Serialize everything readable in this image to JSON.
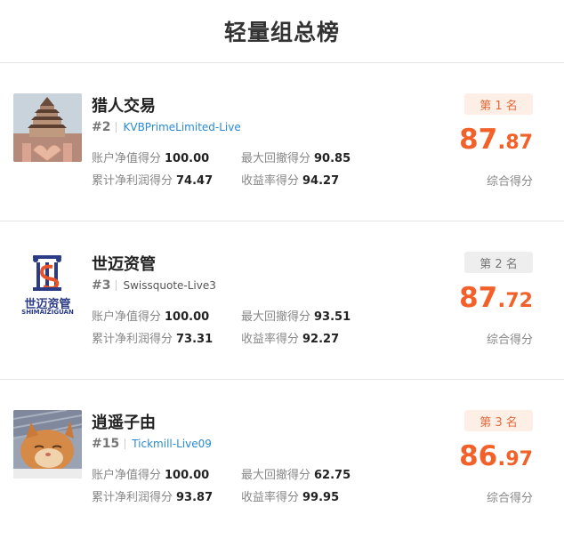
{
  "page": {
    "title": "轻量组总榜"
  },
  "entries": [
    {
      "name": "猎人交易",
      "rank_no": "#2",
      "account": "KVBPrimeLimited-Live",
      "badge": "第 1 名",
      "score_int": "87",
      "score_dec": "87",
      "score_label": "综合得分",
      "stats": [
        {
          "label": "账户净值得分",
          "value": "100.00"
        },
        {
          "label": "最大回撤得分",
          "value": "90.85"
        },
        {
          "label": "累计净利润得分",
          "value": "74.47"
        },
        {
          "label": "收益率得分",
          "value": "94.27"
        }
      ]
    },
    {
      "name": "世迈资管",
      "rank_no": "#3",
      "account": "Swissquote-Live3",
      "badge": "第 2 名",
      "score_int": "87",
      "score_dec": "72",
      "score_label": "综合得分",
      "logo": {
        "cn": "世迈资管",
        "en": "SHIMAIZIGUAN"
      },
      "stats": [
        {
          "label": "账户净值得分",
          "value": "100.00"
        },
        {
          "label": "最大回撤得分",
          "value": "93.51"
        },
        {
          "label": "累计净利润得分",
          "value": "73.31"
        },
        {
          "label": "收益率得分",
          "value": "92.27"
        }
      ]
    },
    {
      "name": "逍遥子由",
      "rank_no": "#15",
      "account": "Tickmill-Live09",
      "badge": "第 3 名",
      "score_int": "86",
      "score_dec": "97",
      "score_label": "综合得分",
      "stats": [
        {
          "label": "账户净值得分",
          "value": "100.00"
        },
        {
          "label": "最大回撤得分",
          "value": "62.75"
        },
        {
          "label": "累计净利润得分",
          "value": "93.87"
        },
        {
          "label": "收益率得分",
          "value": "99.95"
        }
      ]
    }
  ],
  "colors": {
    "accent": "#f2612a",
    "link": "#2a8ad4",
    "badge_gold_bg": "#fdeee6",
    "badge_grey_bg": "#eeeeee"
  }
}
